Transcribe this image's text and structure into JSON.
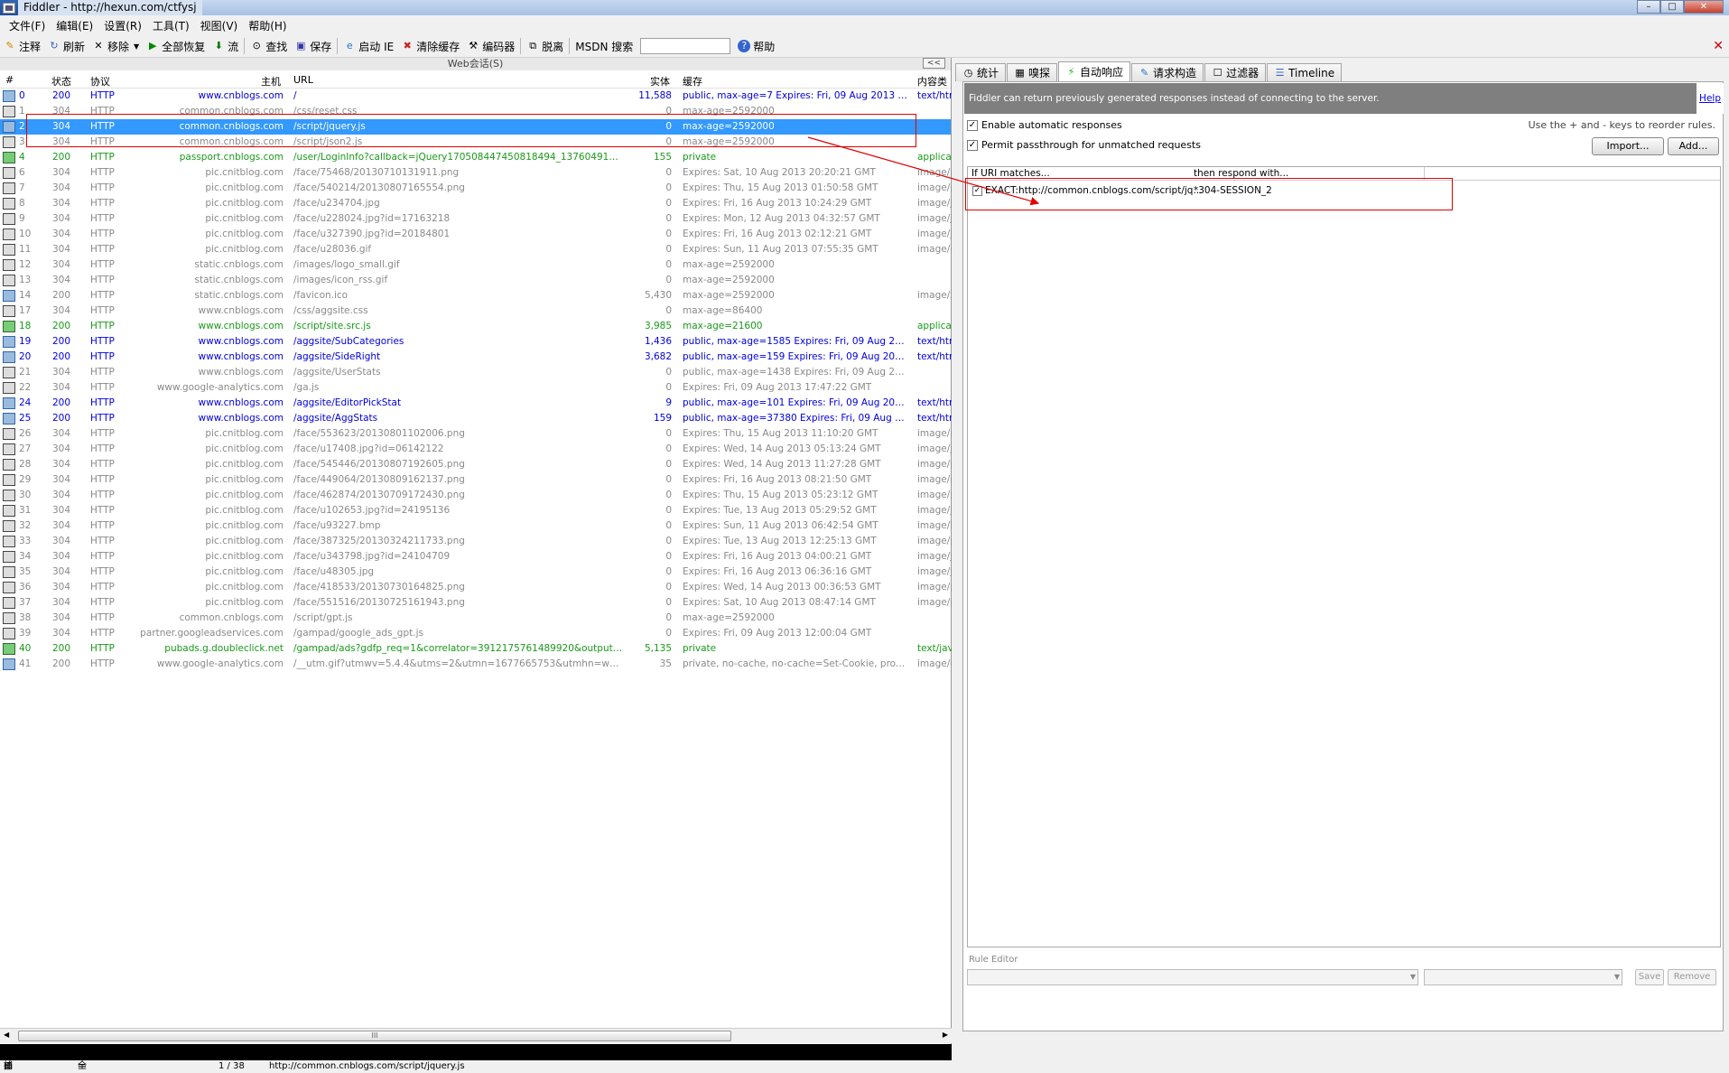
{
  "window": {
    "title": "Fiddler - http://hexun.com/ctfysj"
  },
  "menu": [
    "文件(F)",
    "编辑(E)",
    "设置(R)",
    "工具(T)",
    "视图(V)",
    "帮助(H)"
  ],
  "toolbar": {
    "comment": "注释",
    "refresh": "刷新",
    "remove": "移除",
    "resume_all": "全部恢复",
    "stream": "流",
    "find": "查找",
    "save": "保存",
    "launch_ie": "启动 IE",
    "clear_cache": "清除缓存",
    "encoder": "编码器",
    "detach": "脱离",
    "msdn_search": "MSDN 搜索",
    "help": "帮助"
  },
  "sessions": {
    "pane_title": "Web会话(S)",
    "collapse": "<<",
    "columns": {
      "num": "#",
      "status": "状态",
      "protocol": "协议",
      "host": "主机",
      "url": "URL",
      "body": "实体",
      "caching": "缓存",
      "content_type": "内容类"
    },
    "rows": [
      {
        "num": "0",
        "status": "200",
        "protocol": "HTTP",
        "host": "www.cnblogs.com",
        "url": "/",
        "body": "11,588",
        "caching": "public, max-age=7  Expires: Fri, 09 Aug 2013 11...",
        "ctype": "text/htm",
        "color": "blue",
        "icon": "b"
      },
      {
        "num": "1",
        "status": "304",
        "protocol": "HTTP",
        "host": "common.cnblogs.com",
        "url": "/css/reset.css",
        "body": "0",
        "caching": "max-age=2592000",
        "ctype": "",
        "color": "gray",
        "icon": ""
      },
      {
        "num": "2",
        "status": "304",
        "protocol": "HTTP",
        "host": "common.cnblogs.com",
        "url": "/script/jquery.js",
        "body": "0",
        "caching": "max-age=2592000",
        "ctype": "",
        "color": "sel",
        "icon": "b"
      },
      {
        "num": "3",
        "status": "304",
        "protocol": "HTTP",
        "host": "common.cnblogs.com",
        "url": "/script/json2.js",
        "body": "0",
        "caching": "max-age=2592000",
        "ctype": "",
        "color": "gray",
        "icon": ""
      },
      {
        "num": "4",
        "status": "200",
        "protocol": "HTTP",
        "host": "passport.cnblogs.com",
        "url": "/user/LoginInfo?callback=jQuery170508447450818494_137604912264...",
        "body": "155",
        "caching": "private",
        "ctype": "applicat",
        "color": "green",
        "icon": "g"
      },
      {
        "num": "6",
        "status": "304",
        "protocol": "HTTP",
        "host": "pic.cnitblog.com",
        "url": "/face/75468/20130710131911.png",
        "body": "0",
        "caching": "Expires: Sat, 10 Aug 2013 20:20:21 GMT",
        "ctype": "image/p",
        "color": "gray",
        "icon": ""
      },
      {
        "num": "7",
        "status": "304",
        "protocol": "HTTP",
        "host": "pic.cnitblog.com",
        "url": "/face/540214/20130807165554.png",
        "body": "0",
        "caching": "Expires: Thu, 15 Aug 2013 01:50:58 GMT",
        "ctype": "image/p",
        "color": "gray",
        "icon": ""
      },
      {
        "num": "8",
        "status": "304",
        "protocol": "HTTP",
        "host": "pic.cnitblog.com",
        "url": "/face/u234704.jpg",
        "body": "0",
        "caching": "Expires: Fri, 16 Aug 2013 10:24:29 GMT",
        "ctype": "image/j",
        "color": "gray",
        "icon": ""
      },
      {
        "num": "9",
        "status": "304",
        "protocol": "HTTP",
        "host": "pic.cnitblog.com",
        "url": "/face/u228024.jpg?id=17163218",
        "body": "0",
        "caching": "Expires: Mon, 12 Aug 2013 04:32:57 GMT",
        "ctype": "image/j",
        "color": "gray",
        "icon": ""
      },
      {
        "num": "10",
        "status": "304",
        "protocol": "HTTP",
        "host": "pic.cnitblog.com",
        "url": "/face/u327390.jpg?id=20184801",
        "body": "0",
        "caching": "Expires: Fri, 16 Aug 2013 02:12:21 GMT",
        "ctype": "image/j",
        "color": "gray",
        "icon": ""
      },
      {
        "num": "11",
        "status": "304",
        "protocol": "HTTP",
        "host": "pic.cnitblog.com",
        "url": "/face/u28036.gif",
        "body": "0",
        "caching": "Expires: Sun, 11 Aug 2013 07:55:35 GMT",
        "ctype": "image/g",
        "color": "gray",
        "icon": ""
      },
      {
        "num": "12",
        "status": "304",
        "protocol": "HTTP",
        "host": "static.cnblogs.com",
        "url": "/images/logo_small.gif",
        "body": "0",
        "caching": "max-age=2592000",
        "ctype": "",
        "color": "gray",
        "icon": ""
      },
      {
        "num": "13",
        "status": "304",
        "protocol": "HTTP",
        "host": "static.cnblogs.com",
        "url": "/images/icon_rss.gif",
        "body": "0",
        "caching": "max-age=2592000",
        "ctype": "",
        "color": "gray",
        "icon": ""
      },
      {
        "num": "14",
        "status": "200",
        "protocol": "HTTP",
        "host": "static.cnblogs.com",
        "url": "/favicon.ico",
        "body": "5,430",
        "caching": "max-age=2592000",
        "ctype": "image/x-",
        "color": "gray",
        "icon": "b"
      },
      {
        "num": "17",
        "status": "304",
        "protocol": "HTTP",
        "host": "www.cnblogs.com",
        "url": "/css/aggsite.css",
        "body": "0",
        "caching": "max-age=86400",
        "ctype": "",
        "color": "gray",
        "icon": ""
      },
      {
        "num": "18",
        "status": "200",
        "protocol": "HTTP",
        "host": "www.cnblogs.com",
        "url": "/script/site.src.js",
        "body": "3,985",
        "caching": "max-age=21600",
        "ctype": "applicat",
        "color": "green",
        "icon": "g"
      },
      {
        "num": "19",
        "status": "200",
        "protocol": "HTTP",
        "host": "www.cnblogs.com",
        "url": "/aggsite/SubCategories",
        "body": "1,436",
        "caching": "public, max-age=1585  Expires: Fri, 09 Aug 2013...",
        "ctype": "text/htm",
        "color": "blue",
        "icon": "b"
      },
      {
        "num": "20",
        "status": "200",
        "protocol": "HTTP",
        "host": "www.cnblogs.com",
        "url": "/aggsite/SideRight",
        "body": "3,682",
        "caching": "public, max-age=159  Expires: Fri, 09 Aug 2013 ...",
        "ctype": "text/htm",
        "color": "blue",
        "icon": "b"
      },
      {
        "num": "21",
        "status": "304",
        "protocol": "HTTP",
        "host": "www.cnblogs.com",
        "url": "/aggsite/UserStats",
        "body": "0",
        "caching": "public, max-age=1438  Expires: Fri, 09 Aug 2013...",
        "ctype": "",
        "color": "gray",
        "icon": ""
      },
      {
        "num": "22",
        "status": "304",
        "protocol": "HTTP",
        "host": "www.google-analytics.com",
        "url": "/ga.js",
        "body": "0",
        "caching": "Expires: Fri, 09 Aug 2013 17:47:22 GMT",
        "ctype": "",
        "color": "gray",
        "icon": ""
      },
      {
        "num": "24",
        "status": "200",
        "protocol": "HTTP",
        "host": "www.cnblogs.com",
        "url": "/aggsite/EditorPickStat",
        "body": "9",
        "caching": "public, max-age=101  Expires: Fri, 09 Aug 2013 ...",
        "ctype": "text/htm",
        "color": "blue",
        "icon": "b"
      },
      {
        "num": "25",
        "status": "200",
        "protocol": "HTTP",
        "host": "www.cnblogs.com",
        "url": "/aggsite/AggStats",
        "body": "159",
        "caching": "public, max-age=37380  Expires: Fri, 09 Aug 201...",
        "ctype": "text/htm",
        "color": "blue",
        "icon": "b"
      },
      {
        "num": "26",
        "status": "304",
        "protocol": "HTTP",
        "host": "pic.cnitblog.com",
        "url": "/face/553623/20130801102006.png",
        "body": "0",
        "caching": "Expires: Thu, 15 Aug 2013 11:10:20 GMT",
        "ctype": "image/p",
        "color": "gray",
        "icon": ""
      },
      {
        "num": "27",
        "status": "304",
        "protocol": "HTTP",
        "host": "pic.cnitblog.com",
        "url": "/face/u17408.jpg?id=06142122",
        "body": "0",
        "caching": "Expires: Wed, 14 Aug 2013 05:13:24 GMT",
        "ctype": "image/j",
        "color": "gray",
        "icon": ""
      },
      {
        "num": "28",
        "status": "304",
        "protocol": "HTTP",
        "host": "pic.cnitblog.com",
        "url": "/face/545446/20130807192605.png",
        "body": "0",
        "caching": "Expires: Wed, 14 Aug 2013 11:27:28 GMT",
        "ctype": "image/p",
        "color": "gray",
        "icon": ""
      },
      {
        "num": "29",
        "status": "304",
        "protocol": "HTTP",
        "host": "pic.cnitblog.com",
        "url": "/face/449064/20130809162137.png",
        "body": "0",
        "caching": "Expires: Fri, 16 Aug 2013 08:21:50 GMT",
        "ctype": "image/p",
        "color": "gray",
        "icon": ""
      },
      {
        "num": "30",
        "status": "304",
        "protocol": "HTTP",
        "host": "pic.cnitblog.com",
        "url": "/face/462874/20130709172430.png",
        "body": "0",
        "caching": "Expires: Thu, 15 Aug 2013 05:23:12 GMT",
        "ctype": "image/p",
        "color": "gray",
        "icon": ""
      },
      {
        "num": "31",
        "status": "304",
        "protocol": "HTTP",
        "host": "pic.cnitblog.com",
        "url": "/face/u102653.jpg?id=24195136",
        "body": "0",
        "caching": "Expires: Tue, 13 Aug 2013 05:29:52 GMT",
        "ctype": "image/j",
        "color": "gray",
        "icon": ""
      },
      {
        "num": "32",
        "status": "304",
        "protocol": "HTTP",
        "host": "pic.cnitblog.com",
        "url": "/face/u93227.bmp",
        "body": "0",
        "caching": "Expires: Sun, 11 Aug 2013 06:42:54 GMT",
        "ctype": "image/b",
        "color": "gray",
        "icon": ""
      },
      {
        "num": "33",
        "status": "304",
        "protocol": "HTTP",
        "host": "pic.cnitblog.com",
        "url": "/face/387325/20130324211733.png",
        "body": "0",
        "caching": "Expires: Tue, 13 Aug 2013 12:25:13 GMT",
        "ctype": "image/p",
        "color": "gray",
        "icon": ""
      },
      {
        "num": "34",
        "status": "304",
        "protocol": "HTTP",
        "host": "pic.cnitblog.com",
        "url": "/face/u343798.jpg?id=24104709",
        "body": "0",
        "caching": "Expires: Fri, 16 Aug 2013 04:00:21 GMT",
        "ctype": "image/j",
        "color": "gray",
        "icon": ""
      },
      {
        "num": "35",
        "status": "304",
        "protocol": "HTTP",
        "host": "pic.cnitblog.com",
        "url": "/face/u48305.jpg",
        "body": "0",
        "caching": "Expires: Fri, 16 Aug 2013 06:36:16 GMT",
        "ctype": "image/j",
        "color": "gray",
        "icon": ""
      },
      {
        "num": "36",
        "status": "304",
        "protocol": "HTTP",
        "host": "pic.cnitblog.com",
        "url": "/face/418533/20130730164825.png",
        "body": "0",
        "caching": "Expires: Wed, 14 Aug 2013 00:36:53 GMT",
        "ctype": "image/p",
        "color": "gray",
        "icon": ""
      },
      {
        "num": "37",
        "status": "304",
        "protocol": "HTTP",
        "host": "pic.cnitblog.com",
        "url": "/face/551516/20130725161943.png",
        "body": "0",
        "caching": "Expires: Sat, 10 Aug 2013 08:47:14 GMT",
        "ctype": "image/p",
        "color": "gray",
        "icon": ""
      },
      {
        "num": "38",
        "status": "304",
        "protocol": "HTTP",
        "host": "common.cnblogs.com",
        "url": "/script/gpt.js",
        "body": "0",
        "caching": "max-age=2592000",
        "ctype": "",
        "color": "gray",
        "icon": ""
      },
      {
        "num": "39",
        "status": "304",
        "protocol": "HTTP",
        "host": "partner.googleadservices.com",
        "url": "/gampad/google_ads_gpt.js",
        "body": "0",
        "caching": "Expires: Fri, 09 Aug 2013 12:00:04 GMT",
        "ctype": "",
        "color": "gray",
        "icon": ""
      },
      {
        "num": "40",
        "status": "200",
        "protocol": "HTTP",
        "host": "pubads.g.doubleclick.net",
        "url": "/gampad/ads?gdfp_req=1&correlator=3912175761489920&output=json...",
        "body": "5,135",
        "caching": "private",
        "ctype": "text/jav",
        "color": "green",
        "icon": "g"
      },
      {
        "num": "41",
        "status": "200",
        "protocol": "HTTP",
        "host": "www.google-analytics.com",
        "url": "/__utm.gif?utmwv=5.4.4&utms=2&utmn=1677665753&utmhn=www.cnb...",
        "body": "35",
        "caching": "private, no-cache, no-cache=Set-Cookie, proxy-...",
        "ctype": "image/g",
        "color": "gray",
        "icon": "b"
      }
    ]
  },
  "tabs": [
    {
      "label": "统计",
      "icon": "clock-icon"
    },
    {
      "label": "嗅探",
      "icon": "inspect-icon"
    },
    {
      "label": "自动响应",
      "icon": "lightning-icon",
      "active": true
    },
    {
      "label": "请求构造",
      "icon": "composer-icon"
    },
    {
      "label": "过滤器",
      "icon": "filter-icon"
    },
    {
      "label": "Timeline",
      "icon": "timeline-icon"
    }
  ],
  "autoresponder": {
    "banner": "Fiddler can return previously generated responses instead of connecting to the server.",
    "help": "Help",
    "enable_label": "Enable automatic responses",
    "passthrough_label": "Permit passthrough for unmatched requests",
    "reorder_hint": "Use the + and - keys to reorder rules.",
    "import": "Import...",
    "add": "Add...",
    "col_match": "If URI matches...",
    "col_respond": "then respond with...",
    "rule_match": "EXACT:http://common.cnblogs.com/script/jq...",
    "rule_respond": "*304-SESSION_2",
    "rule_editor": "Rule Editor",
    "save": "Save",
    "remove": "Remove"
  },
  "status": {
    "capture": "捕捉",
    "processes": "全部进程",
    "count": "1 / 38",
    "url": "http://common.cnblogs.com/script/jquery.js"
  },
  "colors": {
    "selected": "#3399ff",
    "blue_row": "#0000e0",
    "green_row": "#1a9a1a",
    "gray_row": "#8a8a8a",
    "annotation": "#e00000"
  }
}
